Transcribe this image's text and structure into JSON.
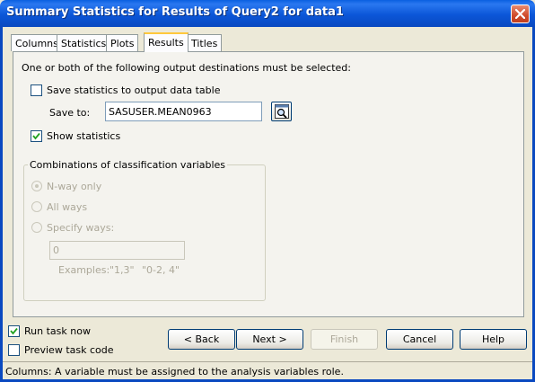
{
  "window": {
    "title": "Summary Statistics for Results of Query2 for data1"
  },
  "tabs": [
    {
      "label": "Columns",
      "active": false
    },
    {
      "label": "Statistics",
      "active": false
    },
    {
      "label": "Plots",
      "active": false
    },
    {
      "label": "Results",
      "active": true
    },
    {
      "label": "Titles",
      "active": false
    }
  ],
  "results": {
    "instruction": "One or both of the following output destinations must be selected:",
    "save_statistics": {
      "label": "Save statistics to output data table",
      "checked": false
    },
    "save_to": {
      "label": "Save to:",
      "value": "SASUSER.MEAN0963"
    },
    "show_statistics": {
      "label": "Show statistics",
      "checked": true
    },
    "combinations": {
      "legend": "Combinations of classification variables",
      "options": [
        {
          "label": "N-way only",
          "selected": true
        },
        {
          "label": "All ways",
          "selected": false
        },
        {
          "label": "Specify ways:",
          "selected": false
        }
      ],
      "ways_value": "0",
      "examples_label": "Examples:",
      "example_1": "\"1,3\"",
      "example_2": "\"0-2, 4\""
    }
  },
  "footer": {
    "run_task_now": {
      "label": "Run task now",
      "checked": true
    },
    "preview_task_code": {
      "label": "Preview task code",
      "checked": false
    },
    "buttons": {
      "back": "< Back",
      "next": "Next >",
      "finish": "Finish",
      "cancel": "Cancel",
      "help": "Help"
    }
  },
  "status": "Columns: A variable must be assigned to the analysis variables role.",
  "colors": {
    "titlebar": "#0a5fe0",
    "close": "#cf4b2a",
    "tab_highlight": "#ffc83c",
    "dialog_bg": "#ece9d8"
  }
}
